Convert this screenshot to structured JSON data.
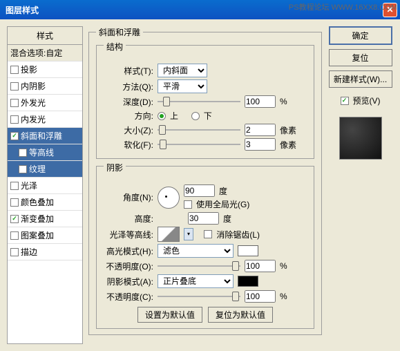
{
  "watermark": "PS教程论坛 WWW.16XX8.COM",
  "title": "图层样式",
  "left": {
    "header": "样式",
    "blend": "混合选项:自定",
    "items": [
      {
        "label": "投影",
        "checked": false,
        "sel": false
      },
      {
        "label": "内阴影",
        "checked": false,
        "sel": false
      },
      {
        "label": "外发光",
        "checked": false,
        "sel": false
      },
      {
        "label": "内发光",
        "checked": false,
        "sel": false
      },
      {
        "label": "斜面和浮雕",
        "checked": true,
        "sel": true
      },
      {
        "label": "等高线",
        "checked": false,
        "sel": true,
        "sub": true
      },
      {
        "label": "纹理",
        "checked": false,
        "sel": true,
        "sub": true
      },
      {
        "label": "光泽",
        "checked": false,
        "sel": false
      },
      {
        "label": "颜色叠加",
        "checked": false,
        "sel": false
      },
      {
        "label": "渐变叠加",
        "checked": true,
        "sel": false
      },
      {
        "label": "图案叠加",
        "checked": false,
        "sel": false
      },
      {
        "label": "描边",
        "checked": false,
        "sel": false
      }
    ]
  },
  "sections": {
    "main_title": "斜面和浮雕",
    "structure": {
      "legend": "结构",
      "style_label": "样式(T):",
      "style_value": "内斜面",
      "method_label": "方法(Q):",
      "method_value": "平滑",
      "depth_label": "深度(D):",
      "depth_value": "100",
      "depth_unit": "%",
      "dir_label": "方向:",
      "dir_up": "上",
      "dir_down": "下",
      "size_label": "大小(Z):",
      "size_value": "2",
      "size_unit": "像素",
      "soften_label": "软化(F):",
      "soften_value": "3",
      "soften_unit": "像素"
    },
    "shadow": {
      "legend": "阴影",
      "angle_label": "角度(N):",
      "angle_value": "90",
      "angle_unit": "度",
      "global_label": "使用全局光(G)",
      "alt_label": "高度:",
      "alt_value": "30",
      "alt_unit": "度",
      "contour_label": "光泽等高线:",
      "anti_label": "消除锯齿(L)",
      "hl_mode_label": "高光模式(H):",
      "hl_mode_value": "滤色",
      "hl_opacity_label": "不透明度(O):",
      "hl_opacity_value": "100",
      "opacity_unit": "%",
      "sh_mode_label": "阴影模式(A):",
      "sh_mode_value": "正片叠底",
      "sh_opacity_label": "不透明度(C):",
      "sh_opacity_value": "100"
    },
    "bottom": {
      "default": "设置为默认值",
      "reset": "复位为默认值"
    }
  },
  "right": {
    "ok": "确定",
    "cancel": "复位",
    "new_style": "新建样式(W)...",
    "preview": "预览(V)"
  }
}
